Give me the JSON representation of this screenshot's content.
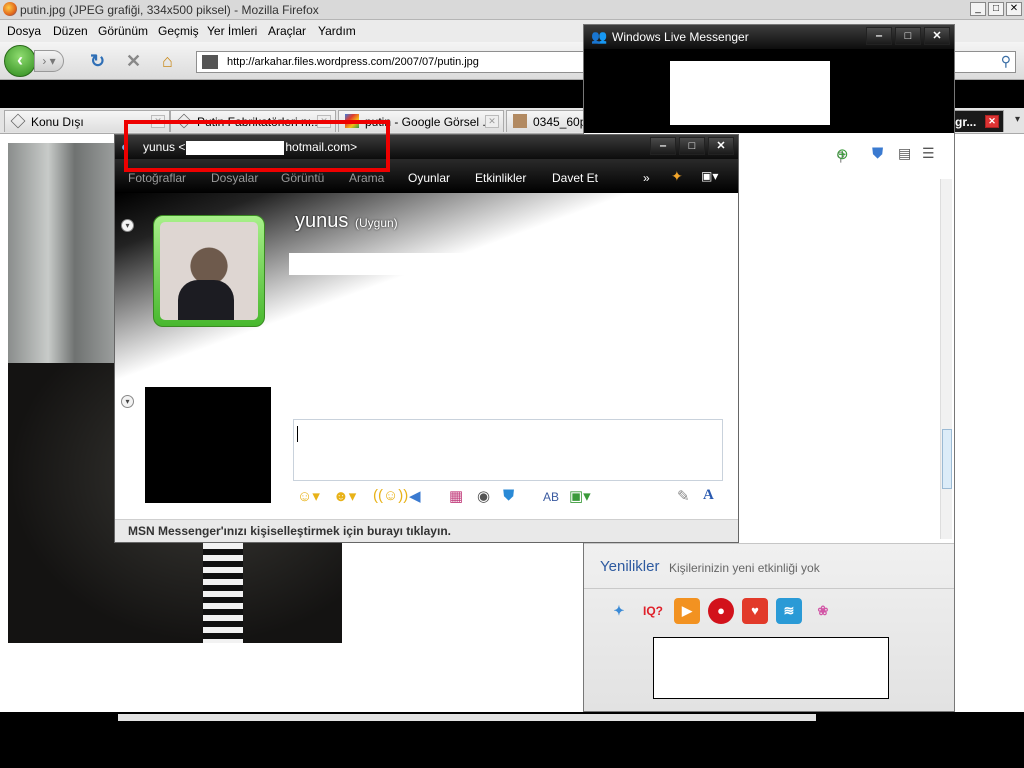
{
  "firefox": {
    "title": "putin.jpg (JPEG grafiği, 334x500 piksel) - Mozilla Firefox",
    "menus": [
      "Dosya",
      "Düzen",
      "Görünüm",
      "Geçmiş",
      "Yer İmleri",
      "Araçlar",
      "Yardım"
    ],
    "url": "http://arkahar.files.wordpress.com/2007/07/putin.jpg",
    "tabs": [
      "Konu Dışı",
      "Putin Fabrikatörleri nı...",
      "putin - Google Görsel ...",
      "0345_60p",
      "gr..."
    ],
    "window_buttons": [
      "_",
      "□",
      "✕"
    ]
  },
  "wlm_main": {
    "title": "Windows Live Messenger",
    "window_buttons": [
      "‒",
      "□",
      "✕"
    ],
    "news_title": "Yenilikler",
    "news_subtitle": "Kişilerinizin yeni etkinliği yok",
    "apps": [
      "IQ?"
    ]
  },
  "conversation": {
    "title_prefix": "yunus <",
    "title_suffix": "hotmail.com>",
    "window_buttons": [
      "‒",
      "□",
      "✕"
    ],
    "toolbar_items": [
      "Fotoğraflar",
      "Dosyalar",
      "Görüntü",
      "Arama",
      "Oyunlar",
      "Etkinlikler",
      "Davet Et"
    ],
    "toolbar_more": "»",
    "buddy_name": "yunus",
    "buddy_status": "(Uygun)",
    "footer": "MSN Messenger'ınızı kişiselleştirmek için burayı tıklayın.",
    "format_font": "A",
    "format_spell": "AB"
  },
  "colors": {
    "highlight_box": "#e00000",
    "news_title": "#2d5aa0"
  }
}
